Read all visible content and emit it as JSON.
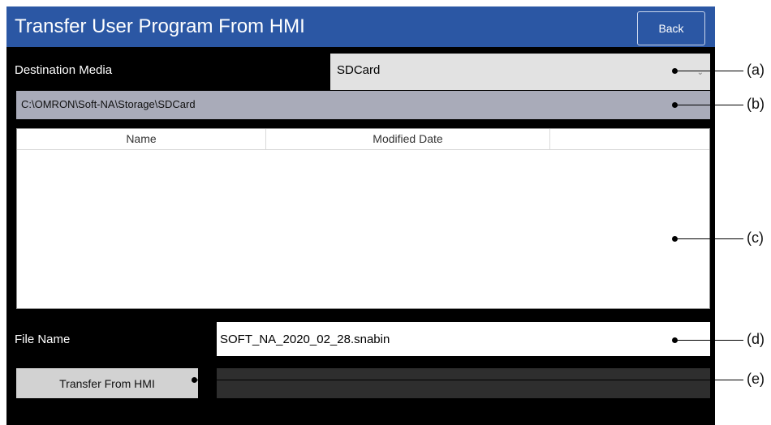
{
  "window": {
    "title": "Transfer User Program From HMI",
    "back_label": "Back"
  },
  "destination": {
    "label": "Destination Media",
    "selected": "SDCard",
    "path": "C:\\OMRON\\Soft-NA\\Storage\\SDCard"
  },
  "file_list": {
    "columns": [
      "Name",
      "Modified Date",
      ""
    ],
    "rows": []
  },
  "file_name": {
    "label": "File Name",
    "value": "SOFT_NA_2020_02_28.snabin"
  },
  "transfer": {
    "button_label": "Transfer From HMI"
  },
  "callouts": [
    "(a)",
    "(b)",
    "(c)",
    "(d)",
    "(e)"
  ],
  "colors": {
    "header": "#2b57a4",
    "background": "#000000",
    "path_bar": "#a9abb9",
    "button": "#d2d2d2"
  },
  "icons": {
    "dropdown": "chevron-down-icon"
  }
}
